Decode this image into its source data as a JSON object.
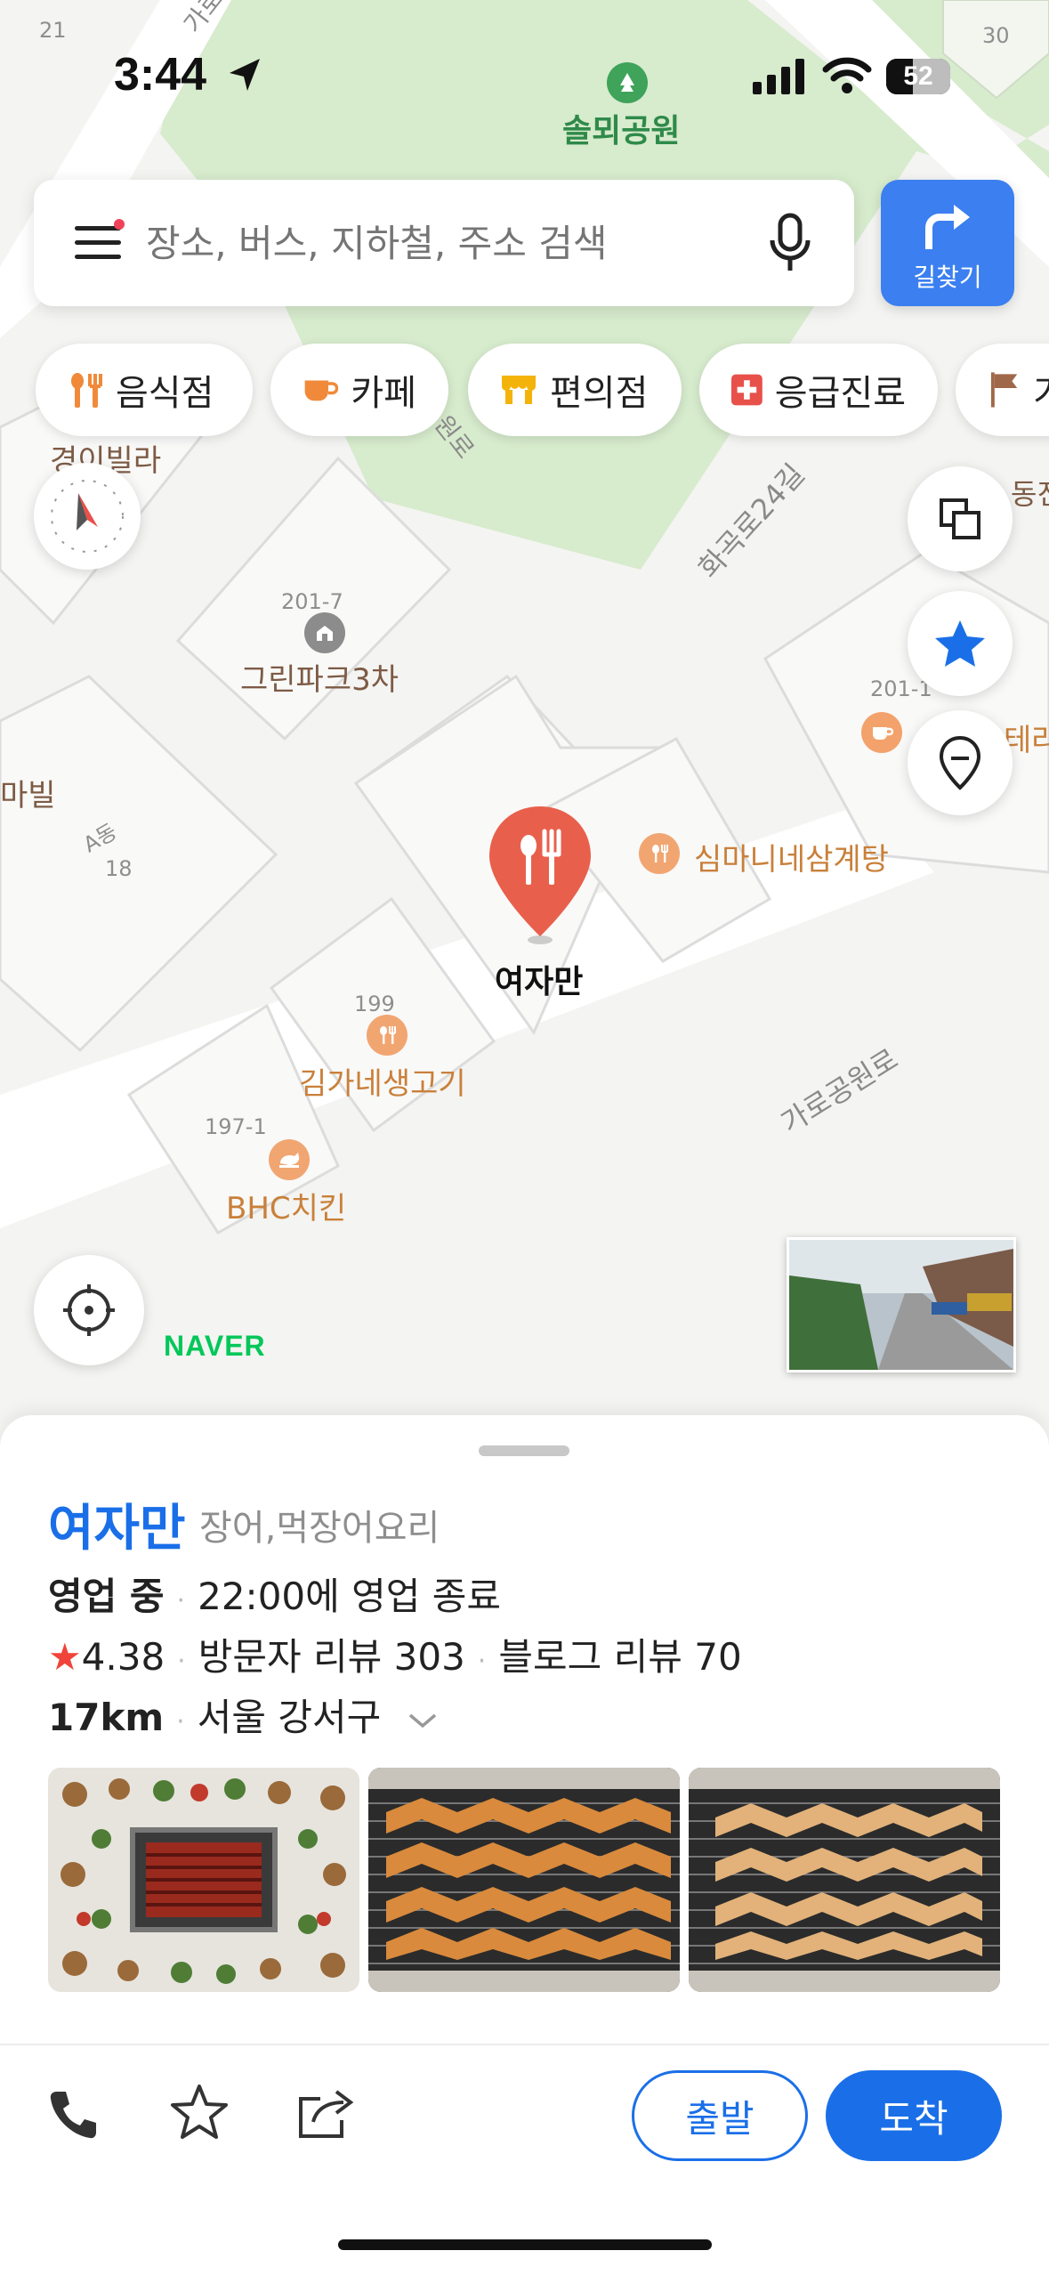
{
  "status_bar": {
    "time": "3:44",
    "battery": "52"
  },
  "map": {
    "park_label": "솔뫼공원",
    "labels": {
      "gyeongi_villa": "경이빌라",
      "greenpark": "그린파크3차",
      "greenpark_addr": "201-7",
      "simamani": "심마니네삼계탕",
      "yeojaman": "여자만",
      "kimga": "김가네생고기",
      "kimga_addr": "199",
      "bhc": "BHC치킨",
      "bhc_addr": "197-1",
      "mabil": "마빌",
      "a_dong": "A동",
      "a_dong_num": "18",
      "addr_201_1": "201-1",
      "terrace_partial": "테라",
      "dong_partial": "동진",
      "num_21": "21",
      "num_30": "30",
      "road_hwagok24": "화곡로24길",
      "road_garo": "가로공원로",
      "road_garo_top": "가로공원로",
      "road_won": "원로"
    },
    "naver_logo": "NAVER"
  },
  "search": {
    "placeholder": "장소, 버스, 지하철, 주소 검색"
  },
  "directions_button": {
    "label": "길찾기"
  },
  "categories": [
    {
      "label": "음식점",
      "icon": "fork-knife-icon"
    },
    {
      "label": "카페",
      "icon": "coffee-icon"
    },
    {
      "label": "편의점",
      "icon": "store-icon"
    },
    {
      "label": "응급진료",
      "icon": "medical-cross-icon"
    },
    {
      "label": "가",
      "icon": "flag-icon"
    }
  ],
  "place": {
    "name": "여자만",
    "category": "장어,먹장어요리",
    "status": "영업 중",
    "hours": "22:00에 영업 종료",
    "rating": "4.38",
    "visitor_reviews": "방문자 리뷰 303",
    "blog_reviews": "블로그 리뷰 70",
    "distance": "17km",
    "location": "서울 강서구"
  },
  "actions": {
    "depart": "출발",
    "arrive": "도착"
  },
  "colors": {
    "accent": "#1a6fe8",
    "poi": "#e8604c",
    "park": "#d7ebcd",
    "naver": "#03c75a"
  }
}
